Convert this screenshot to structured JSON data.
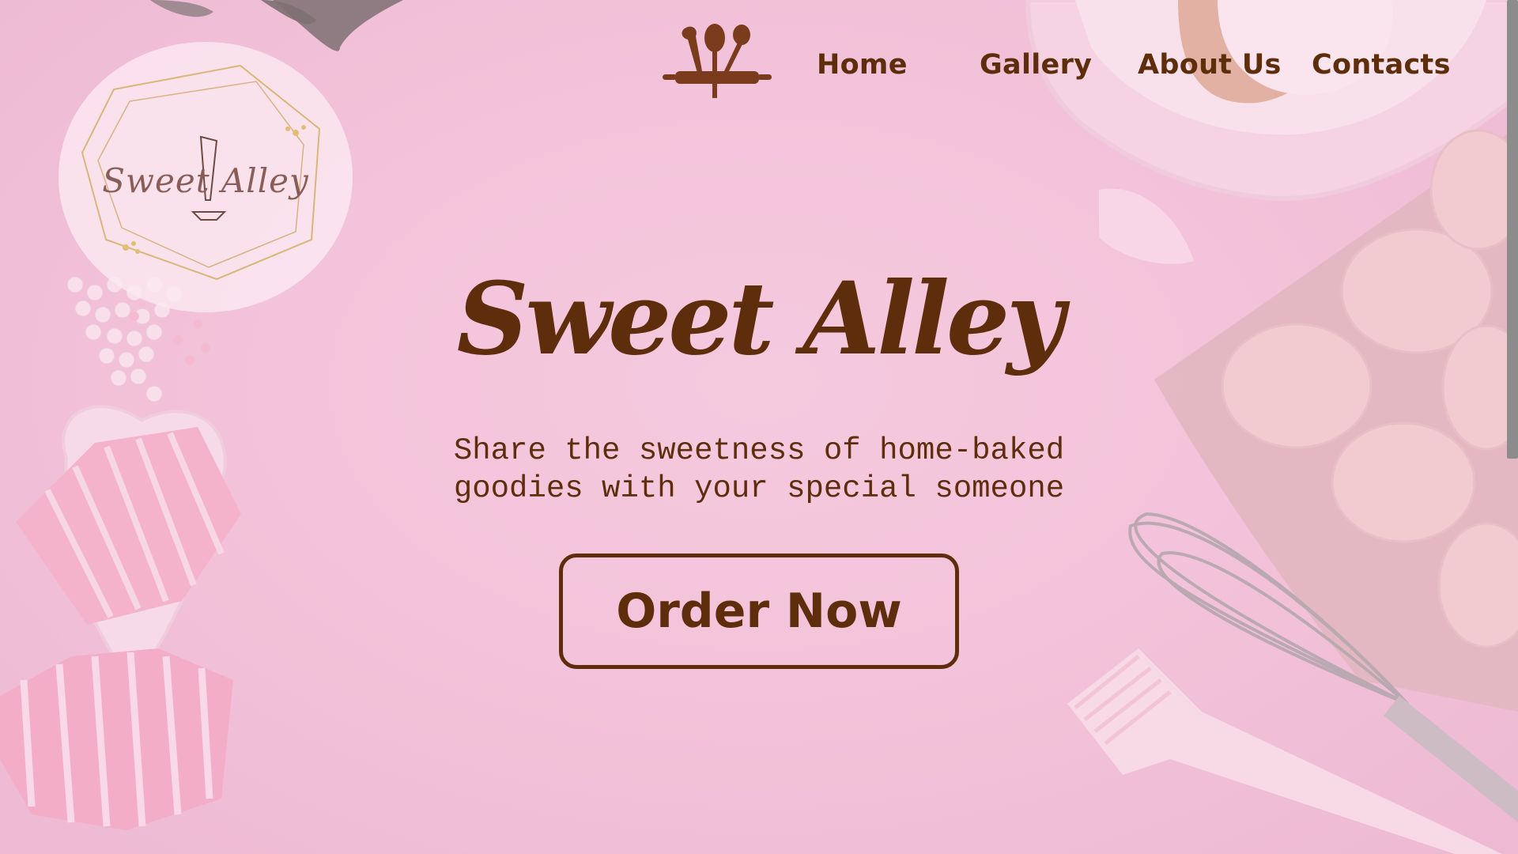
{
  "brand": {
    "title": "Sweet Alley",
    "badge_text": "Sweet Alley"
  },
  "nav": {
    "items": [
      {
        "label": "Home"
      },
      {
        "label": "Gallery"
      },
      {
        "label": "About Us"
      },
      {
        "label": "Contacts"
      }
    ]
  },
  "hero": {
    "tagline_line1": "Share the sweetness of home-baked",
    "tagline_line2": "goodies with your special someone",
    "cta_label": "Order Now"
  },
  "colors": {
    "background": "#f2c6dc",
    "brand_brown": "#5e2d0c"
  },
  "icons": {
    "nav_logo": "baking-utensils-icon",
    "badge": "piping-bag-icon"
  }
}
